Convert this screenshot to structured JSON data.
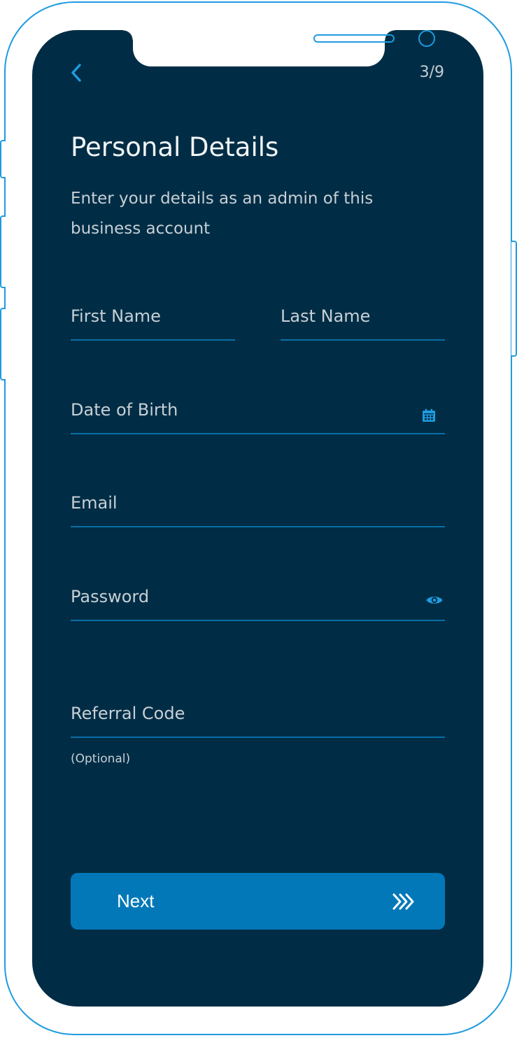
{
  "header": {
    "back_icon": "chevron-left-icon",
    "step_counter": "3/9"
  },
  "page": {
    "title": "Personal Details",
    "subtitle": "Enter your details as an admin of this business account"
  },
  "form": {
    "first_name_label": "First Name",
    "last_name_label": "Last Name",
    "date_of_birth_label": "Date of Birth",
    "date_of_birth_icon": "calendar-icon",
    "email_label": "Email",
    "password_label": "Password",
    "password_icon": "eye-icon",
    "referral_code_label": "Referral Code",
    "referral_code_note": "(Optional)"
  },
  "actions": {
    "next_label": "Next",
    "next_icon": "triple-chevron-right-icon"
  },
  "colors": {
    "screen_background": "#002d45",
    "accent": "#1f9be0",
    "button": "#0378b8",
    "field_underline": "#0a6ea6",
    "text": "#c7cfd6"
  }
}
